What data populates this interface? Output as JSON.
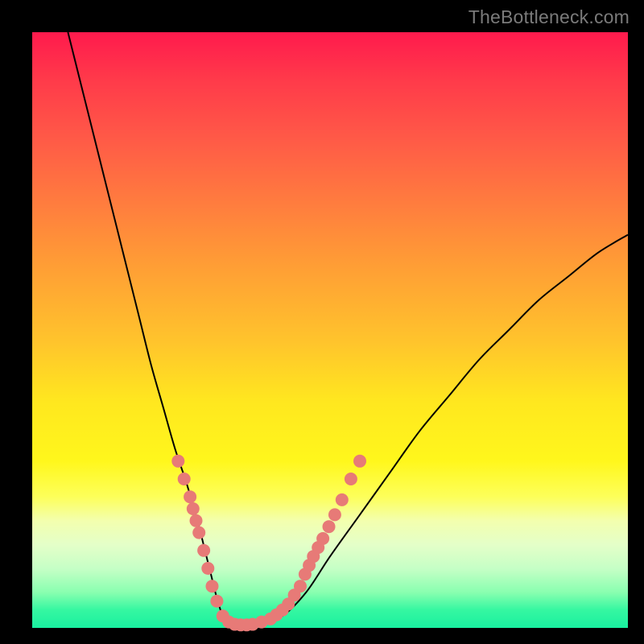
{
  "watermark": "TheBottleneck.com",
  "colors": {
    "background_black": "#000000",
    "gradient_top": "#ff1a4d",
    "gradient_bottom": "#19f0a0",
    "curve_stroke": "#000000",
    "marker_fill": "#e77a77",
    "marker_stroke": "#c95d57"
  },
  "chart_data": {
    "type": "line",
    "title": "",
    "xlabel": "",
    "ylabel": "",
    "xlim": [
      0,
      100
    ],
    "ylim": [
      0,
      100
    ],
    "series": [
      {
        "name": "bottleneck-curve",
        "x": [
          6,
          8,
          10,
          12,
          14,
          16,
          18,
          20,
          22,
          24,
          26,
          28,
          29,
          30,
          31,
          32,
          33,
          35,
          38,
          42,
          46,
          50,
          55,
          60,
          65,
          70,
          75,
          80,
          85,
          90,
          95,
          100
        ],
        "y": [
          100,
          92,
          84,
          76,
          68,
          60,
          52,
          44,
          37,
          30,
          24,
          17,
          13,
          9,
          5,
          2,
          1,
          0.5,
          0.5,
          2,
          6,
          12,
          19,
          26,
          33,
          39,
          45,
          50,
          55,
          59,
          63,
          66
        ]
      }
    ],
    "markers": [
      {
        "x": 24.5,
        "y": 28
      },
      {
        "x": 25.5,
        "y": 25
      },
      {
        "x": 26.5,
        "y": 22
      },
      {
        "x": 27.0,
        "y": 20
      },
      {
        "x": 27.5,
        "y": 18
      },
      {
        "x": 28.0,
        "y": 16
      },
      {
        "x": 28.8,
        "y": 13
      },
      {
        "x": 29.5,
        "y": 10
      },
      {
        "x": 30.2,
        "y": 7
      },
      {
        "x": 31.0,
        "y": 4.5
      },
      {
        "x": 32.0,
        "y": 2
      },
      {
        "x": 33.0,
        "y": 1
      },
      {
        "x": 34.0,
        "y": 0.6
      },
      {
        "x": 35.0,
        "y": 0.5
      },
      {
        "x": 36.0,
        "y": 0.5
      },
      {
        "x": 37.0,
        "y": 0.6
      },
      {
        "x": 38.5,
        "y": 1
      },
      {
        "x": 40.0,
        "y": 1.5
      },
      {
        "x": 41.0,
        "y": 2.2
      },
      {
        "x": 42.0,
        "y": 3
      },
      {
        "x": 43.0,
        "y": 4
      },
      {
        "x": 44.0,
        "y": 5.5
      },
      {
        "x": 45.0,
        "y": 7
      },
      {
        "x": 45.8,
        "y": 9
      },
      {
        "x": 46.5,
        "y": 10.5
      },
      {
        "x": 47.2,
        "y": 12
      },
      {
        "x": 48.0,
        "y": 13.5
      },
      {
        "x": 48.8,
        "y": 15
      },
      {
        "x": 49.8,
        "y": 17
      },
      {
        "x": 50.8,
        "y": 19
      },
      {
        "x": 52.0,
        "y": 21.5
      },
      {
        "x": 53.5,
        "y": 25
      },
      {
        "x": 55.0,
        "y": 28
      }
    ]
  }
}
